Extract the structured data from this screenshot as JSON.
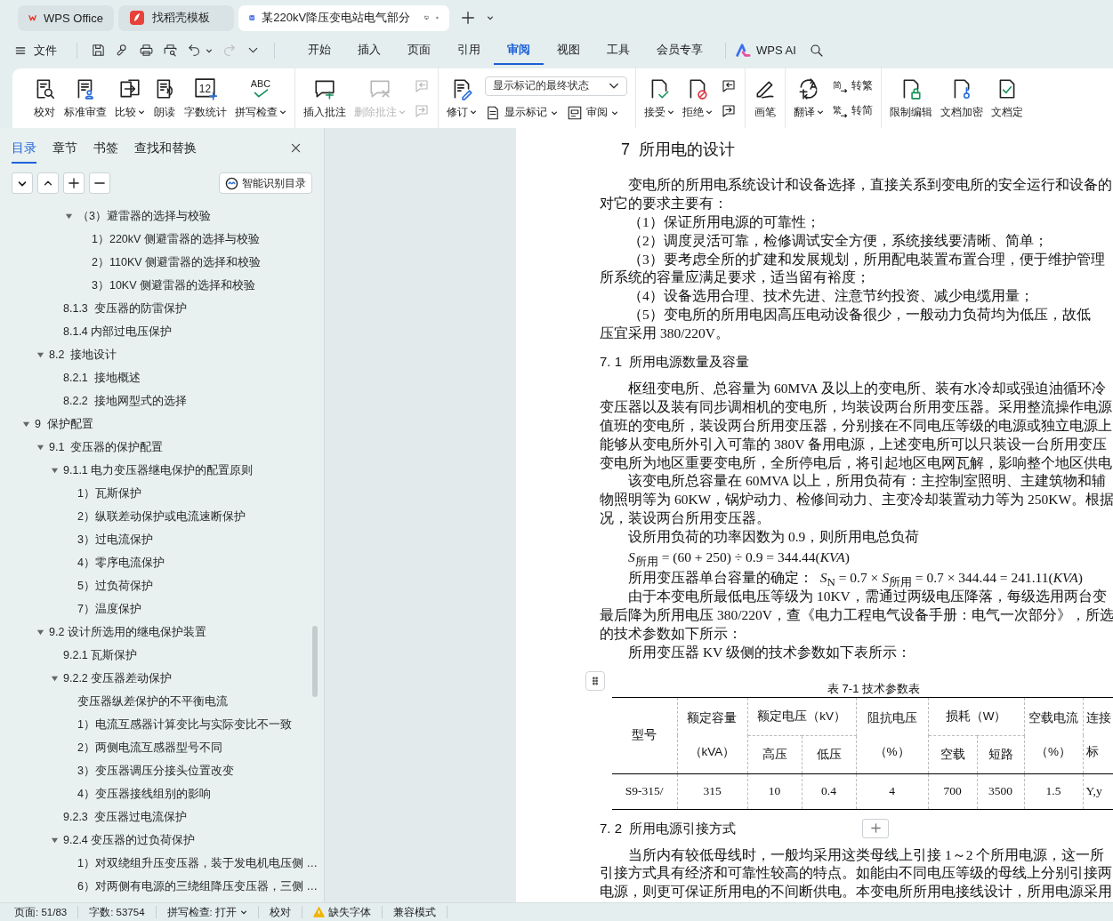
{
  "title_bar": {
    "tabs": [
      {
        "label": "WPS Office",
        "selected": false
      },
      {
        "label": "找稻壳模板",
        "selected": false
      },
      {
        "label": "某220kV降压变电站电气部分",
        "selected": true
      }
    ]
  },
  "menu_bar": {
    "file_label": "文件",
    "quick_access": [
      {
        "dropdown": false,
        "disabled": false
      },
      {
        "dropdown": false,
        "disabled": false
      },
      {
        "dropdown": false,
        "disabled": false
      },
      {
        "dropdown": false,
        "disabled": false
      },
      {
        "dropdown": true,
        "disabled": false
      },
      {
        "dropdown": false,
        "disabled": true
      },
      {
        "dropdown": false,
        "disabled": false
      }
    ],
    "tabs": [
      {
        "label": "开始",
        "selected": false
      },
      {
        "label": "插入",
        "selected": false
      },
      {
        "label": "页面",
        "selected": false
      },
      {
        "label": "引用",
        "selected": false
      },
      {
        "label": "审阅",
        "selected": true
      },
      {
        "label": "视图",
        "selected": false
      },
      {
        "label": "工具",
        "selected": false
      },
      {
        "label": "会员专享",
        "selected": false
      }
    ],
    "ai_label": "WPS AI"
  },
  "ribbon": {
    "groups": [
      {
        "items": [
          {
            "kind": "large",
            "label": "校对",
            "dropdown": false,
            "disabled": false
          },
          {
            "kind": "large",
            "label": "标准审查",
            "dropdown": false,
            "disabled": false
          },
          {
            "kind": "large",
            "label": "比较",
            "dropdown": true,
            "disabled": false
          },
          {
            "kind": "large",
            "label": "朗读",
            "dropdown": false,
            "disabled": false
          },
          {
            "kind": "large",
            "label": "字数统计",
            "icon_text": "12",
            "dropdown": false,
            "disabled": false
          },
          {
            "kind": "large",
            "label": "拼写检查",
            "icon_text": "ABC",
            "dropdown": true,
            "disabled": false
          }
        ]
      },
      {
        "items": [
          {
            "kind": "large",
            "label": "插入批注",
            "dropdown": false,
            "disabled": false
          },
          {
            "kind": "large",
            "label": "删除批注",
            "dropdown": true,
            "disabled": true
          },
          {
            "kind": "stack",
            "rows": [
              [
                {
                  "kind": "icon",
                  "disabled": true
                }
              ],
              [
                {
                  "kind": "icon",
                  "disabled": true
                }
              ]
            ]
          }
        ]
      },
      {
        "items": [
          {
            "kind": "large",
            "label": "修订",
            "dropdown": true,
            "disabled": false
          },
          {
            "kind": "stack",
            "rows": [
              [
                {
                  "kind": "select",
                  "value": "显示标记的最终状态"
                }
              ],
              [
                {
                  "kind": "small",
                  "label": "显示标记",
                  "dropdown": true,
                  "disabled": false
                },
                {
                  "kind": "small",
                  "label": "审阅",
                  "dropdown": true,
                  "disabled": false
                }
              ]
            ]
          }
        ]
      },
      {
        "items": [
          {
            "kind": "large",
            "label": "接受",
            "dropdown": true,
            "disabled": false
          },
          {
            "kind": "large",
            "label": "拒绝",
            "dropdown": true,
            "disabled": false
          },
          {
            "kind": "stack",
            "rows": [
              [
                {
                  "kind": "icon",
                  "disabled": false
                }
              ],
              [
                {
                  "kind": "icon",
                  "disabled": false
                }
              ]
            ]
          }
        ]
      },
      {
        "items": [
          {
            "kind": "large",
            "label": "画笔",
            "dropdown": false,
            "disabled": false
          }
        ]
      },
      {
        "items": [
          {
            "kind": "large",
            "label": "翻译",
            "dropdown": true,
            "disabled": false
          },
          {
            "kind": "stack",
            "rows": [
              [
                {
                  "kind": "small",
                  "label": "转繁",
                  "icon_text": "简",
                  "dropdown": false,
                  "disabled": false
                }
              ],
              [
                {
                  "kind": "small",
                  "label": "转简",
                  "icon_text": "繁",
                  "dropdown": false,
                  "disabled": false
                }
              ]
            ]
          }
        ]
      },
      {
        "items": [
          {
            "kind": "large",
            "label": "限制编辑",
            "dropdown": false,
            "disabled": false
          },
          {
            "kind": "large",
            "label": "文档加密",
            "dropdown": false,
            "disabled": false
          },
          {
            "kind": "large",
            "label": "文档定",
            "dropdown": false,
            "disabled": false
          }
        ]
      }
    ]
  },
  "sidebar": {
    "tabs": [
      {
        "label": "目录",
        "selected": true
      },
      {
        "label": "章节",
        "selected": false
      },
      {
        "label": "书签",
        "selected": false
      },
      {
        "label": "查找和替换",
        "selected": false
      }
    ],
    "smart_toc_label": "智能识别目录",
    "toc": [
      {
        "children": [
          {
            "children": [
              {
                "children": [
                  {
                    "label": "（3）避雷器的选择与校验",
                    "expanded": true,
                    "children": [
                      {
                        "label": "1）220kV 侧避雷器的选择与校验"
                      },
                      {
                        "label": "2）110KV 侧避雷器的选择和校验"
                      },
                      {
                        "label": "3）10KV 侧避雷器的选择和校验"
                      }
                    ]
                  }
                ]
              },
              {
                "label": "8.1.3  变压器的防雷保护"
              },
              {
                "label": "8.1.4 内部过电压保护"
              }
            ]
          },
          {
            "label": "8.2  接地设计",
            "expanded": true,
            "children": [
              {
                "label": "8.2.1  接地概述"
              },
              {
                "label": "8.2.2  接地网型式的选择"
              }
            ]
          }
        ]
      },
      {
        "label": "9  保护配置",
        "expanded": true,
        "children": [
          {
            "label": "9.1  变压器的保护配置",
            "expanded": true,
            "children": [
              {
                "label": "9.1.1 电力变压器继电保护的配置原则",
                "expanded": true,
                "children": [
                  {
                    "label": "1）瓦斯保护"
                  },
                  {
                    "label": "2）纵联差动保护或电流速断保护"
                  },
                  {
                    "label": "3）过电流保护"
                  },
                  {
                    "label": "4）零序电流保护"
                  },
                  {
                    "label": "5）过负荷保护"
                  },
                  {
                    "label": "7）温度保护"
                  }
                ]
              }
            ]
          },
          {
            "label": "9.2 设计所选用的继电保护装置",
            "expanded": true,
            "children": [
              {
                "label": "9.2.1 瓦斯保护"
              },
              {
                "label": "9.2.2 变压器差动保护",
                "expanded": true,
                "children": [
                  {
                    "label": "变压器纵差保护的不平衡电流"
                  },
                  {
                    "label": "1）电流互感器计算变比与实际变比不一致"
                  },
                  {
                    "label": "2）两侧电流互感器型号不同"
                  },
                  {
                    "label": "3）变压器调压分接头位置改变"
                  },
                  {
                    "label": "4）变压器接线组别的影响"
                  }
                ]
              },
              {
                "label": "9.2.3  变压器过电流保护"
              },
              {
                "label": "9.2.4 变压器的过负荷保护",
                "expanded": true,
                "children": [
                  {
                    "label": "1）对双绕组升压变压器，装于发电机电压侧 …"
                  },
                  {
                    "label": "6）对两侧有电源的三绕组降压变压器，三侧 …"
                  }
                ]
              }
            ]
          }
        ]
      }
    ]
  },
  "document": {
    "blocks": [
      {
        "kind": "heading1",
        "text": "7  所用电的设计"
      },
      {
        "kind": "line",
        "indent": true,
        "text": "变电所的所用电系统设计和设备选择，直接关系到变电所的安全运行和设备的"
      },
      {
        "kind": "line",
        "indent": false,
        "text": "对它的要求主要有："
      },
      {
        "kind": "line",
        "indent": true,
        "text": "（1）保证所用电源的可靠性；"
      },
      {
        "kind": "line",
        "indent": true,
        "text": "（2）调度灵活可靠，检修调试安全方便，系统接线要清晰、简单；"
      },
      {
        "kind": "line",
        "indent": true,
        "text": "（3）要考虑全所的扩建和发展规划，所用配电装置布置合理，便于维护管理"
      },
      {
        "kind": "line",
        "indent": false,
        "text": "所系统的容量应满足要求，适当留有裕度；"
      },
      {
        "kind": "line",
        "indent": true,
        "text": "（4）设备选用合理、技术先进、注意节约投资、减少电缆用量；"
      },
      {
        "kind": "line",
        "indent": true,
        "text": "（5）变电所的所用电因高压电动设备很少，一般动力负荷均为低压，故低"
      },
      {
        "kind": "line",
        "indent": false,
        "text": "压宜采用 380/220V。"
      },
      {
        "kind": "heading2",
        "text": "7. 1  所用电源数量及容量"
      },
      {
        "kind": "line",
        "indent": true,
        "text": "枢纽变电所、总容量为 60MVA 及以上的变电所、装有水冷却或强迫油循环冷"
      },
      {
        "kind": "line",
        "indent": false,
        "text": "变压器以及装有同步调相机的变电所，均装设两台所用变压器。采用整流操作电源"
      },
      {
        "kind": "line",
        "indent": false,
        "text": "值班的变电所，装设两台所用变压器，分别接在不同电压等级的电源或独立电源上"
      },
      {
        "kind": "line",
        "indent": false,
        "text": "能够从变电所外引入可靠的 380V 备用电源，上述变电所可以只装设一台所用变压"
      },
      {
        "kind": "line",
        "indent": false,
        "text": "变电所为地区重要变电所，全所停电后，将引起地区电网瓦解，影响整个地区供电"
      },
      {
        "kind": "line",
        "indent": true,
        "text": "该变电所总容量在 60MVA 以上，所用负荷有：主控制室照明、主建筑物和辅"
      },
      {
        "kind": "line",
        "indent": false,
        "text": "物照明等为 60KW，锅炉动力、检修间动力、主变冷却装置动力等为 250KW。根据"
      },
      {
        "kind": "line",
        "indent": false,
        "text": "况，装设两台所用变压器。"
      },
      {
        "kind": "line",
        "indent": true,
        "text": "设所用负荷的功率因数为 0.9，则所用电总负荷"
      },
      {
        "kind": "formula",
        "text": "*S*$_{所用}$ = (60 + 250) ÷ 0.9 = 344.44(*KVA*)"
      },
      {
        "kind": "formula",
        "text": "所用变压器单台容量的确定：  *S*$_{N}$ = 0.7 × *S*$_{所用}$ = 0.7 × 344.44 = 241.11(*KVA*)"
      },
      {
        "kind": "line",
        "indent": true,
        "text": "由于本变电所最低电压等级为 10KV，需通过两级电压降落，每级选用两台变"
      },
      {
        "kind": "line",
        "indent": false,
        "text": "最后降为所用电压 380/220V，查《电力工程电气设备手册：电气一次部分》，所选"
      },
      {
        "kind": "line",
        "indent": false,
        "text": "的技术参数如下所示："
      },
      {
        "kind": "line",
        "indent": true,
        "text": "所用变压器 KV 级侧的技术参数如下表所示："
      },
      {
        "kind": "table",
        "caption": "表 7-1  技术参数表",
        "header": [
          [
            {
              "text": "型号",
              "rowspan": 2
            },
            {
              "text": "额定容量（kVA）",
              "rowspan": 2
            },
            {
              "text": "额定电压（kV）",
              "colspan": 2
            },
            {
              "text": "阻抗电压（%）",
              "rowspan": 2
            },
            {
              "text": "损耗（W）",
              "colspan": 2
            },
            {
              "text": "空载电流（%）",
              "rowspan": 2
            },
            {
              "text": "连接标",
              "rowspan": 2
            }
          ],
          [
            {
              "text": "高压"
            },
            {
              "text": "低压"
            },
            {
              "text": "空载"
            },
            {
              "text": "短路"
            }
          ]
        ],
        "rows": [
          [
            "S9-315/",
            "315",
            "10",
            "0.4",
            "4",
            "700",
            "3500",
            "1.5",
            "Y,y"
          ]
        ]
      },
      {
        "kind": "heading2",
        "text": "7. 2  所用电源引接方式"
      },
      {
        "kind": "line",
        "indent": true,
        "text": "当所内有较低母线时，一般均采用这类母线上引接 1～2 个所用电源，这一所"
      },
      {
        "kind": "line",
        "indent": false,
        "text": "引接方式具有经济和可靠性较高的特点。如能由不同电压等级的母线上分别引接两"
      },
      {
        "kind": "line",
        "indent": false,
        "text": "电源，则更可保证所用电的不间断供电。本变电所所用电接线设计，所用电源采用"
      }
    ]
  },
  "status_bar": {
    "page": "页面: 51/83",
    "words": "字数: 53754",
    "spell": "拼写检查: 打开",
    "proof": "校对",
    "missing_font": "缺失字体",
    "compat": "兼容模式"
  }
}
